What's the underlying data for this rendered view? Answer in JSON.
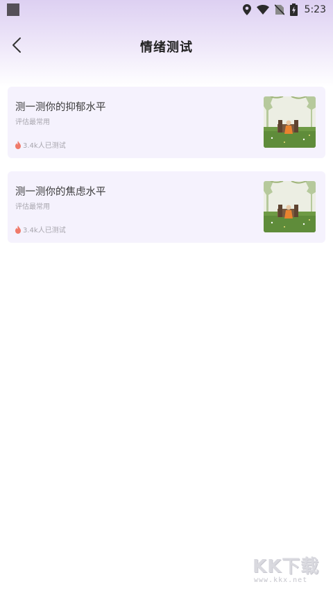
{
  "status_bar": {
    "time": "5:23",
    "icons": [
      "location-icon",
      "wifi-icon",
      "no-sim-icon",
      "battery-charging-icon"
    ]
  },
  "header": {
    "title": "情绪测试",
    "back_icon": "chevron-left-icon"
  },
  "tests": [
    {
      "title": "测一测你的抑郁水平",
      "subtitle": "评估最常用",
      "count": "3.4k人已测试",
      "icon": "fire-icon"
    },
    {
      "title": "测一测你的焦虑水平",
      "subtitle": "评估最常用",
      "count": "3.4k人已测试",
      "icon": "fire-icon"
    }
  ],
  "watermark": {
    "logo": "KK下载",
    "url": "www.kkx.net"
  },
  "colors": {
    "header_gradient_top": "#ddd0f2",
    "card_background": "#f5f2fd",
    "fire": "#f07a6a"
  }
}
